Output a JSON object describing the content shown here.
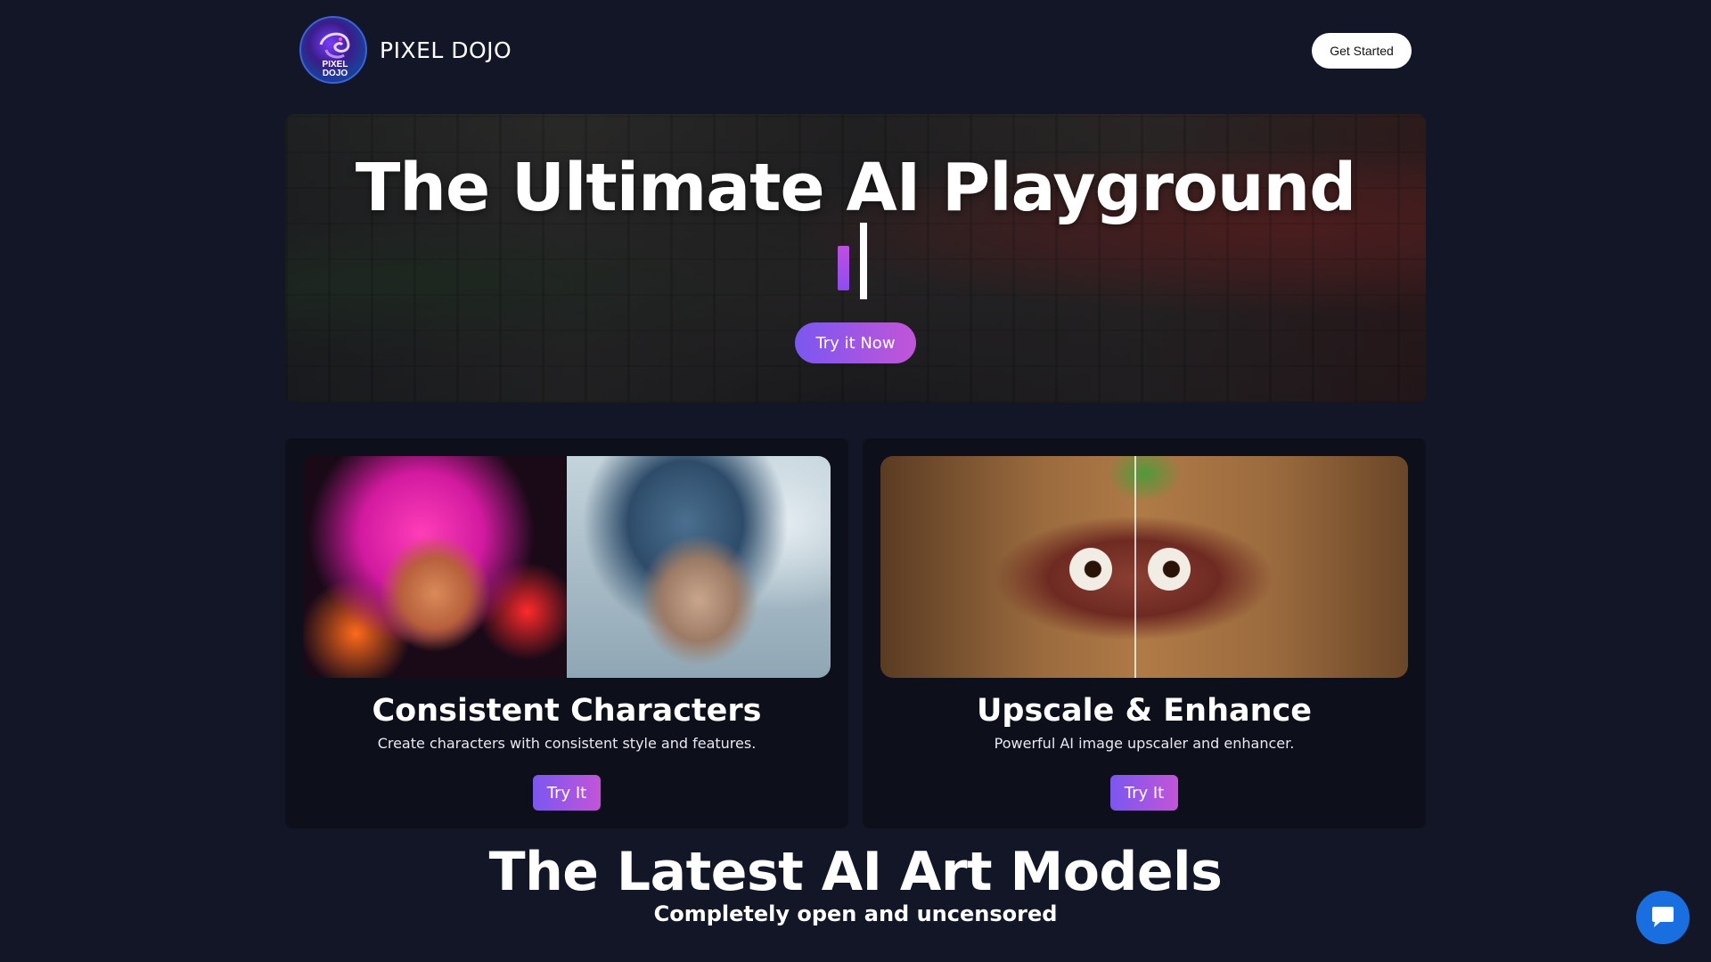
{
  "header": {
    "brand": "PIXEL DOJO",
    "logo_text_top": "PIXEL",
    "logo_text_bottom": "DOJO",
    "get_started_label": "Get Started"
  },
  "hero": {
    "title": "The Ultimate AI Playground",
    "cta_label": "Try it Now"
  },
  "features": [
    {
      "title": "Consistent Characters",
      "description": "Create characters with consistent style and features.",
      "button_label": "Try It"
    },
    {
      "title": "Upscale & Enhance",
      "description": "Powerful AI image upscaler and enhancer.",
      "button_label": "Try It"
    }
  ],
  "models_section": {
    "title": "The Latest AI Art Models",
    "subtitle": "Completely open and uncensored"
  },
  "icons": {
    "logo": "dragon-logo-icon",
    "chat": "chat-bubble-icon"
  },
  "colors": {
    "background": "#121626",
    "card": "#0d0f1a",
    "accent_start": "#7b57f0",
    "accent_end": "#c255d8",
    "chat": "#1a6fe0"
  }
}
